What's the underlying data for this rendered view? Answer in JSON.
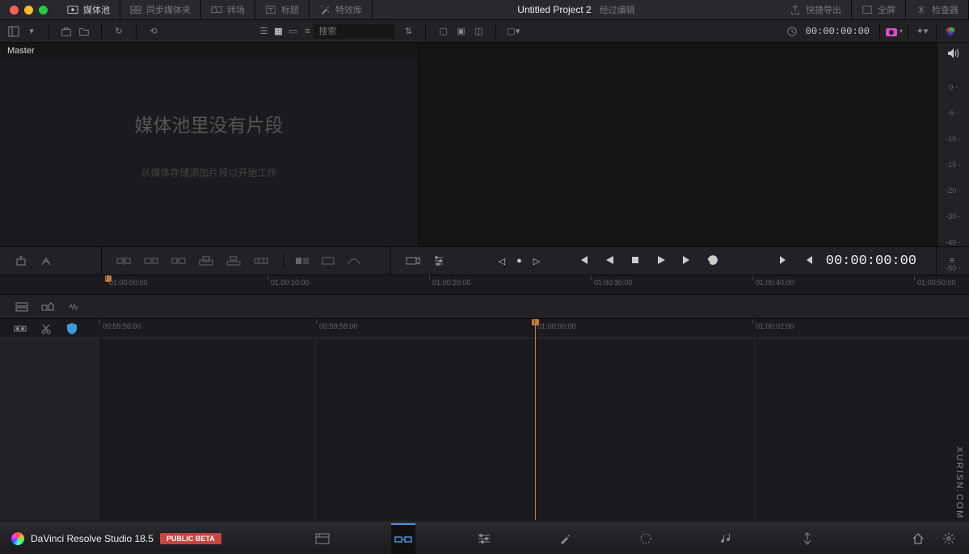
{
  "titlebar": {
    "mediaPool": "媒体池",
    "syncBin": "同步媒体夹",
    "transition": "转场",
    "title": "标题",
    "effects": "特效库",
    "projectTitle": "Untitled Project 2",
    "edited": "经过编辑",
    "quickExport": "快捷导出",
    "fullscreen": "全屏",
    "inspector": "检查器"
  },
  "toolbar2": {
    "searchPlaceholder": "搜索",
    "timecode": "00:00:00:00"
  },
  "mediaPool": {
    "master": "Master",
    "emptyTitle": "媒体池里没有片段",
    "emptySub": "从媒体存储添加片段以开始工作"
  },
  "audioMeter": {
    "scale": [
      "0 -",
      "-5 -",
      "-10 -",
      "-15 -",
      "-20 -",
      "-30 -",
      "-40 -",
      "-50 -"
    ]
  },
  "transport": {
    "timecode": "00:00:00:00"
  },
  "ruler1": {
    "ticks": [
      {
        "label": "01:00:00:00",
        "pos": 10
      },
      {
        "label": "01:00:10:00",
        "pos": 210
      },
      {
        "label": "01:00:20:00",
        "pos": 410
      },
      {
        "label": "01:00:30:00",
        "pos": 610
      },
      {
        "label": "01:00:40:00",
        "pos": 810
      },
      {
        "label": "01:00:50:00",
        "pos": 1010
      }
    ]
  },
  "ruler2": {
    "ticks": [
      {
        "label": "00:59:56:00",
        "pos": 2
      },
      {
        "label": "00:59:58:00",
        "pos": 270
      },
      {
        "label": "01:00:00:00",
        "pos": 540
      },
      {
        "label": "01:00:02:00",
        "pos": 810
      }
    ]
  },
  "bottomNav": {
    "appName": "DaVinci Resolve Studio 18.5",
    "betaLabel": "PUBLIC BETA"
  },
  "watermark": "XURISN.COM",
  "watermark2": "XURISN.COM"
}
